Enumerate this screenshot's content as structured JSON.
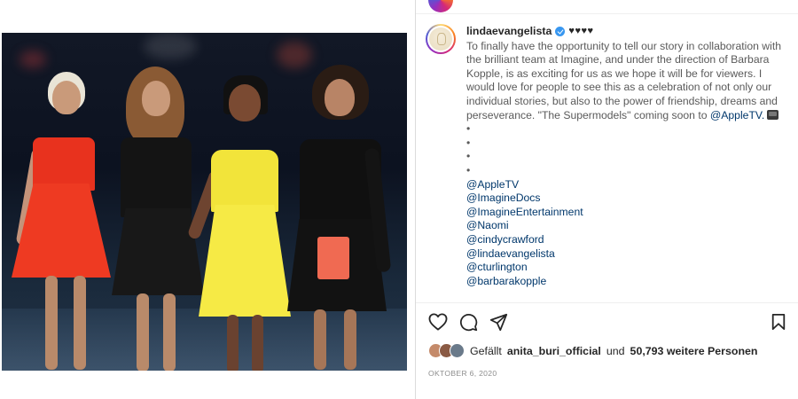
{
  "post": {
    "username": "lindaevangelista",
    "username_suffix": "♥♥♥♥",
    "caption_main": "To finally have the opportunity to tell our story in collaboration with the brilliant team at Imagine, and under the direction of Barbara Kopple, is as exciting for us as we hope it will be for viewers. I would love for people to see this as a celebration of not only our individual stories, but also to the power of friendship, dreams and perseverance. \"The Supermodels\" coming soon to",
    "caption_mention": "@AppleTV.",
    "bullets": [
      "•",
      "•",
      "•",
      "•"
    ],
    "tags": [
      "@AppleTV",
      "@ImagineDocs",
      "@ImagineEntertainment",
      "@Naomi",
      "@cindycrawford",
      "@lindaevangelista",
      "@cturlington",
      "@barbarakopple"
    ],
    "likes": {
      "prefix": "Gefällt",
      "liked_by": "anita_buri_official",
      "connector": "und",
      "count": "50,793 weitere Personen"
    },
    "date": "OKTOBER 6, 2020"
  },
  "icons": {
    "like": "heart-icon",
    "comment": "comment-icon",
    "share": "share-icon",
    "save": "bookmark-icon",
    "verified": "verified-badge-icon"
  },
  "colors": {
    "link": "#00376b",
    "verified": "#3897f0",
    "text": "#262626",
    "muted": "#8e8e8e"
  }
}
